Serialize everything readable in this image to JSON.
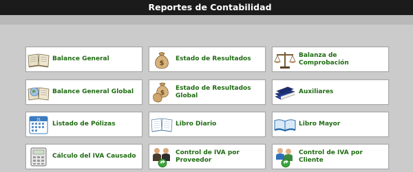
{
  "window": {
    "title": "Reportes de Contabilidad"
  },
  "reports": [
    {
      "label": "Balance General",
      "icon": "open-book-icon"
    },
    {
      "label": "Estado de Resultados",
      "icon": "money-bag-icon"
    },
    {
      "label": "Balanza de Comprobación",
      "icon": "scale-icon"
    },
    {
      "label": "Balance General Global",
      "icon": "book-globe-icon"
    },
    {
      "label": "Estado de Resultados Global",
      "icon": "money-bags-icon"
    },
    {
      "label": "Auxiliares",
      "icon": "books-icon"
    },
    {
      "label": "Listado de Pólizas",
      "icon": "calendar-icon"
    },
    {
      "label": "Libro Diario",
      "icon": "open-ledger-icon"
    },
    {
      "label": "Libro Mayor",
      "icon": "blue-book-icon"
    },
    {
      "label": "Cálculo del IVA Causado",
      "icon": "calculator-icon"
    },
    {
      "label": "Control de IVA por Proveedor",
      "icon": "suppliers-icon"
    },
    {
      "label": "Control de IVA por Cliente",
      "icon": "clients-icon"
    }
  ],
  "colors": {
    "titlebar": "#1b1b1b",
    "label": "#1f6b12",
    "background": "#cbcbcb"
  }
}
